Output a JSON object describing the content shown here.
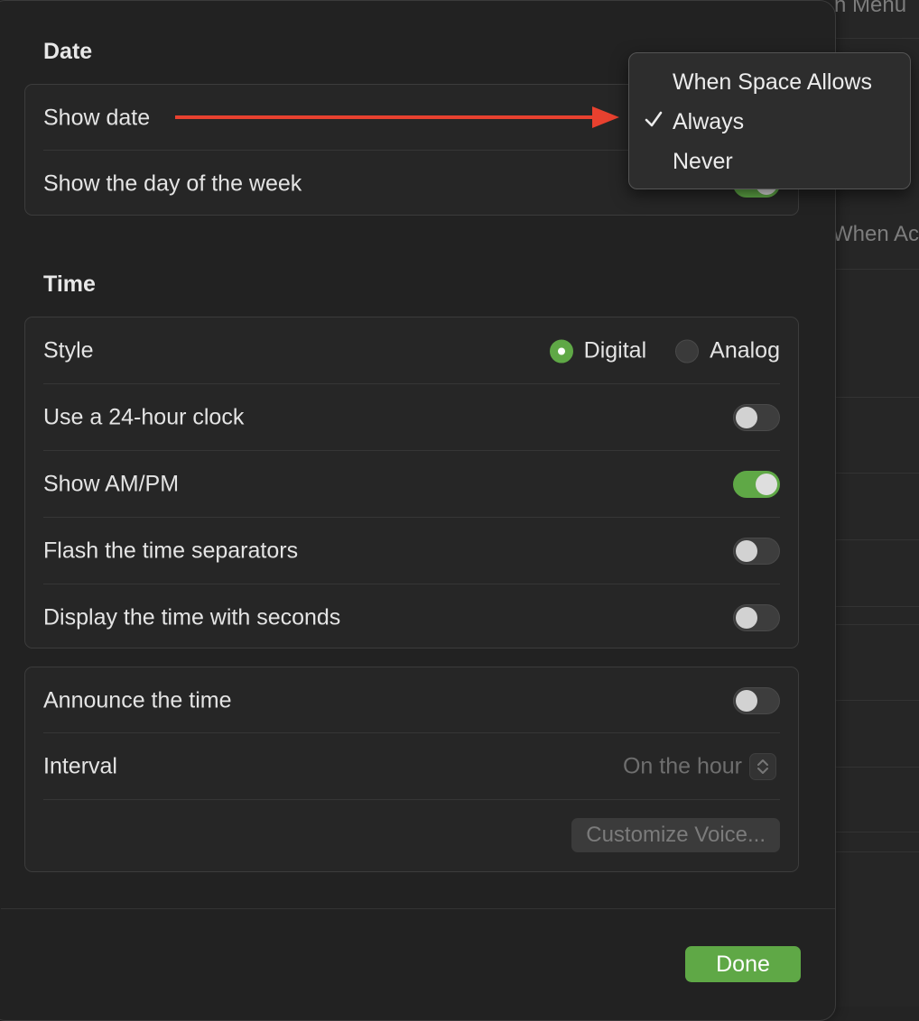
{
  "colors": {
    "accent": "#5fa846",
    "arrow": "#e8412f",
    "background": "#222222"
  },
  "background_window": {
    "texts": [
      "n Menu",
      "When Ac"
    ]
  },
  "date_section": {
    "title": "Date",
    "rows": [
      {
        "label": "Show date",
        "control": "popup",
        "value": "Always"
      },
      {
        "label": "Show the day of the week",
        "control": "toggle",
        "on": true
      }
    ]
  },
  "date_menu": {
    "items": [
      {
        "label": "When Space Allows",
        "checked": false
      },
      {
        "label": "Always",
        "checked": true
      },
      {
        "label": "Never",
        "checked": false
      }
    ],
    "check_icon": "checkmark-icon"
  },
  "annotation": {
    "icon": "red-arrow-icon"
  },
  "time_section": {
    "title": "Time",
    "style": {
      "label": "Style",
      "options": [
        "Digital",
        "Analog"
      ],
      "selected": "Digital"
    },
    "toggles": [
      {
        "label": "Use a 24-hour clock",
        "on": false
      },
      {
        "label": "Show AM/PM",
        "on": true
      },
      {
        "label": "Flash the time separators",
        "on": false
      },
      {
        "label": "Display the time with seconds",
        "on": false
      }
    ]
  },
  "announce_section": {
    "announce": {
      "label": "Announce the time",
      "on": false
    },
    "interval": {
      "label": "Interval",
      "value": "On the hour"
    },
    "customize_button": "Customize Voice..."
  },
  "footer": {
    "done_label": "Done"
  }
}
